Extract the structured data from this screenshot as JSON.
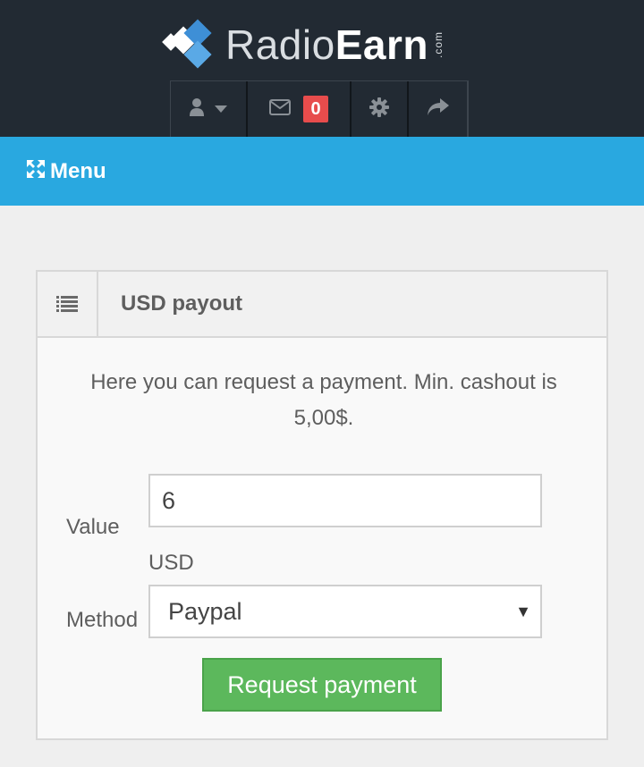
{
  "header": {
    "logo": {
      "prefix": "Radio",
      "bold": "Earn",
      "suffix": ".com"
    },
    "toolbar": {
      "user_icon": "user-icon",
      "mail_icon": "envelope-icon",
      "mail_count": "0",
      "gear_icon": "gear-icon",
      "share_icon": "share-icon"
    }
  },
  "menu": {
    "icon": "expand-icon",
    "label": "Menu"
  },
  "panel": {
    "icon": "list-icon",
    "title": "USD payout",
    "intro": "Here you can request a payment. Min. cashout is 5,00$.",
    "value_label": "Value",
    "value": "6",
    "currency": "USD",
    "method_label": "Method",
    "method_selected": "Paypal",
    "submit_label": "Request payment"
  },
  "colors": {
    "topbar": "#222a33",
    "menubar": "#29a8e0",
    "badge": "#e74c4c",
    "button": "#5cb85c"
  }
}
